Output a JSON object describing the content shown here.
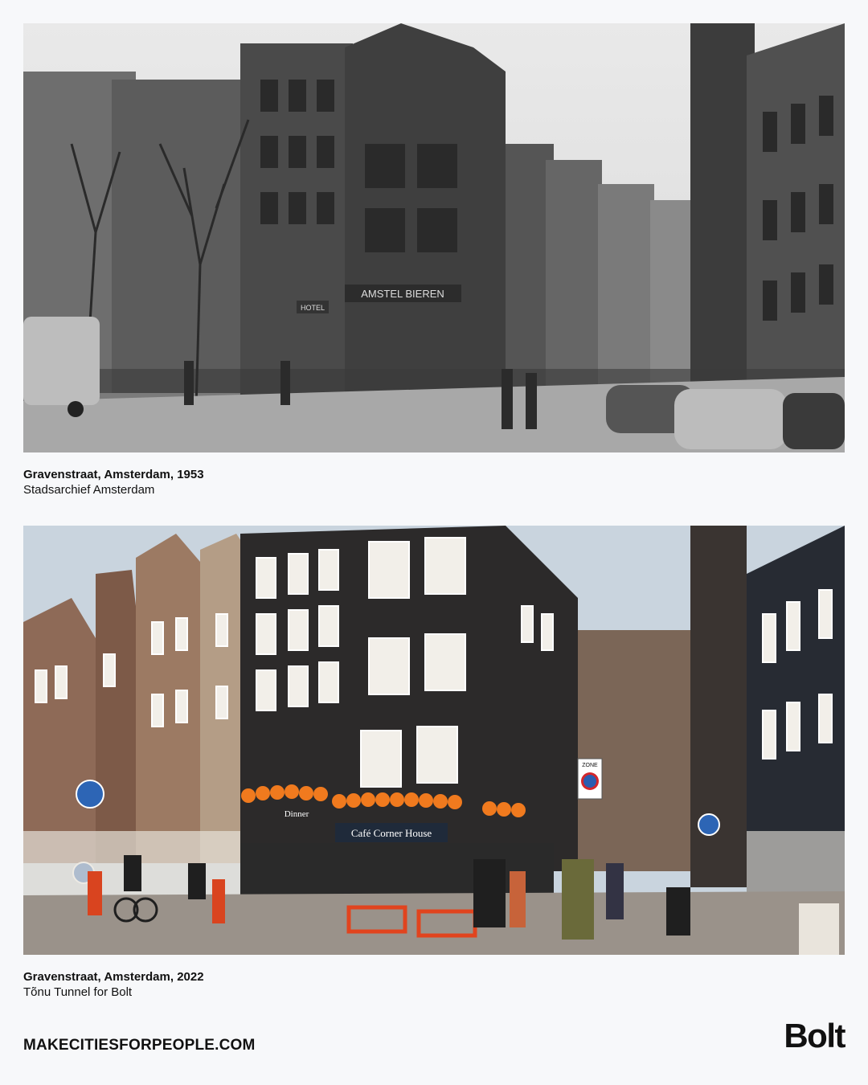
{
  "photos": [
    {
      "title": "Gravenstraat, Amsterdam, 1953",
      "credit": "Stadsarchief Amsterdam",
      "style": "black-and-white",
      "signs": [
        "AMSTEL BIEREN",
        "HOTEL"
      ]
    },
    {
      "title": "Gravenstraat, Amsterdam, 2022",
      "credit": "Tõnu Tunnel for Bolt",
      "style": "color",
      "signs": [
        "Café Corner House",
        "ZONE",
        "Dinner"
      ]
    }
  ],
  "footer": {
    "website": "MAKECITIESFORPEOPLE.COM",
    "logo_text": "Bolt"
  },
  "colors": {
    "background": "#f7f8fa",
    "text": "#111111",
    "balloons": "#f07a1e"
  }
}
